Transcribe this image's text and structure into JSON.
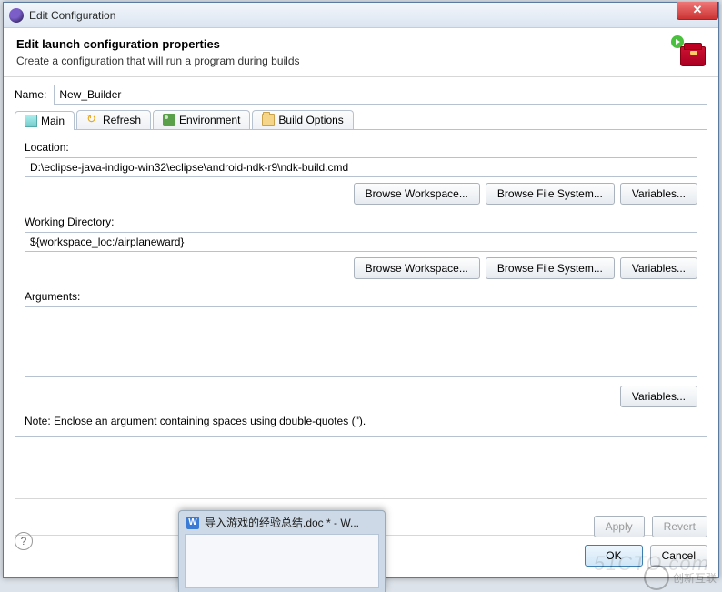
{
  "window": {
    "title": "Edit Configuration"
  },
  "header": {
    "title": "Edit launch configuration properties",
    "subtitle": "Create a configuration that will run a program during builds"
  },
  "name": {
    "label": "Name:",
    "value": "New_Builder"
  },
  "tabs": {
    "main": "Main",
    "refresh": "Refresh",
    "environment": "Environment",
    "build_options": "Build Options"
  },
  "main_tab": {
    "location_label": "Location:",
    "location_value": "D:\\eclipse-java-indigo-win32\\eclipse\\android-ndk-r9\\ndk-build.cmd",
    "workdir_label": "Working Directory:",
    "workdir_value": "${workspace_loc:/airplaneward}",
    "arguments_label": "Arguments:",
    "arguments_value": "",
    "note": "Note: Enclose an argument containing spaces using double-quotes (\")."
  },
  "buttons": {
    "browse_workspace": "Browse Workspace...",
    "browse_filesystem": "Browse File System...",
    "variables": "Variables...",
    "apply": "Apply",
    "revert": "Revert",
    "ok": "OK",
    "cancel": "Cancel"
  },
  "taskbar_preview": {
    "title": "导入游戏的经验总结.doc * - W..."
  },
  "watermark": "51CTO.com",
  "watermark2": "创新互联"
}
